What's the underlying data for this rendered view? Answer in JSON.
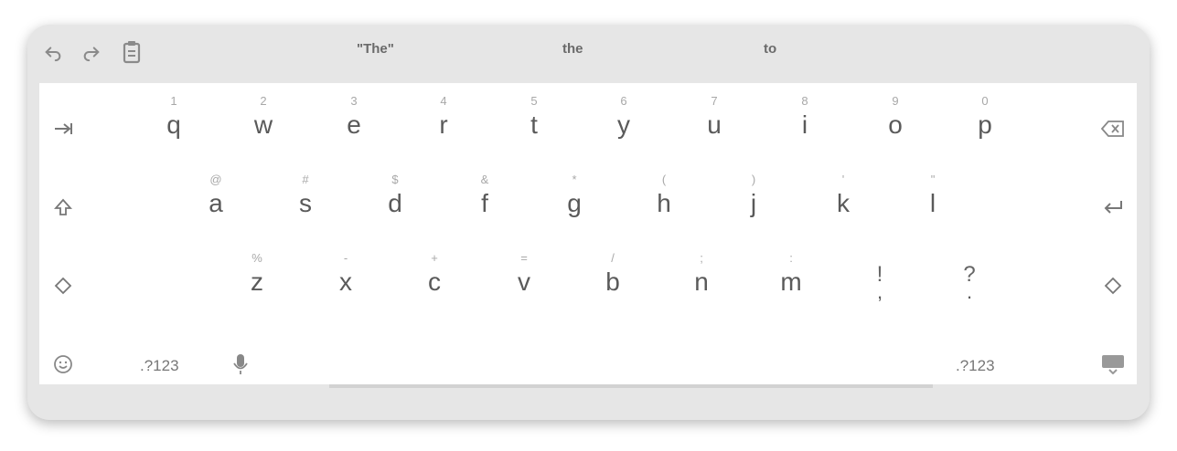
{
  "toolbar": {
    "undo_icon": "undo-icon",
    "redo_icon": "redo-icon",
    "clipboard_icon": "clipboard-icon",
    "suggestions": [
      "\"The\"",
      "the",
      "to"
    ]
  },
  "rows": {
    "row1": [
      {
        "key": "q",
        "hint": "1"
      },
      {
        "key": "w",
        "hint": "2"
      },
      {
        "key": "e",
        "hint": "3"
      },
      {
        "key": "r",
        "hint": "4"
      },
      {
        "key": "t",
        "hint": "5"
      },
      {
        "key": "y",
        "hint": "6"
      },
      {
        "key": "u",
        "hint": "7"
      },
      {
        "key": "i",
        "hint": "8"
      },
      {
        "key": "o",
        "hint": "9"
      },
      {
        "key": "p",
        "hint": "0"
      }
    ],
    "row2": [
      {
        "key": "a",
        "hint": "@"
      },
      {
        "key": "s",
        "hint": "#"
      },
      {
        "key": "d",
        "hint": "$"
      },
      {
        "key": "f",
        "hint": "&"
      },
      {
        "key": "g",
        "hint": "*"
      },
      {
        "key": "h",
        "hint": "("
      },
      {
        "key": "j",
        "hint": ")"
      },
      {
        "key": "k",
        "hint": "'"
      },
      {
        "key": "l",
        "hint": "\""
      }
    ],
    "row3": [
      {
        "key": "z",
        "hint": "%"
      },
      {
        "key": "x",
        "hint": "-"
      },
      {
        "key": "c",
        "hint": "+"
      },
      {
        "key": "v",
        "hint": "="
      },
      {
        "key": "b",
        "hint": "/"
      },
      {
        "key": "n",
        "hint": ";"
      },
      {
        "key": "m",
        "hint": ":"
      }
    ],
    "punct": [
      {
        "upper": "!",
        "lower": ","
      },
      {
        "upper": "?",
        "lower": "."
      }
    ]
  },
  "bottom": {
    "symbols_left": ".?123",
    "symbols_right": ".?123"
  },
  "icons": {
    "tab": "tab-icon",
    "backspace": "backspace-icon",
    "shift_left": "shift-icon",
    "enter": "enter-icon",
    "shift_right": "shift-icon",
    "emoji": "emoji-icon",
    "mic": "microphone-icon",
    "hide": "hide-keyboard-icon",
    "left_diamond": "diamond-icon",
    "right_diamond": "diamond-icon"
  }
}
